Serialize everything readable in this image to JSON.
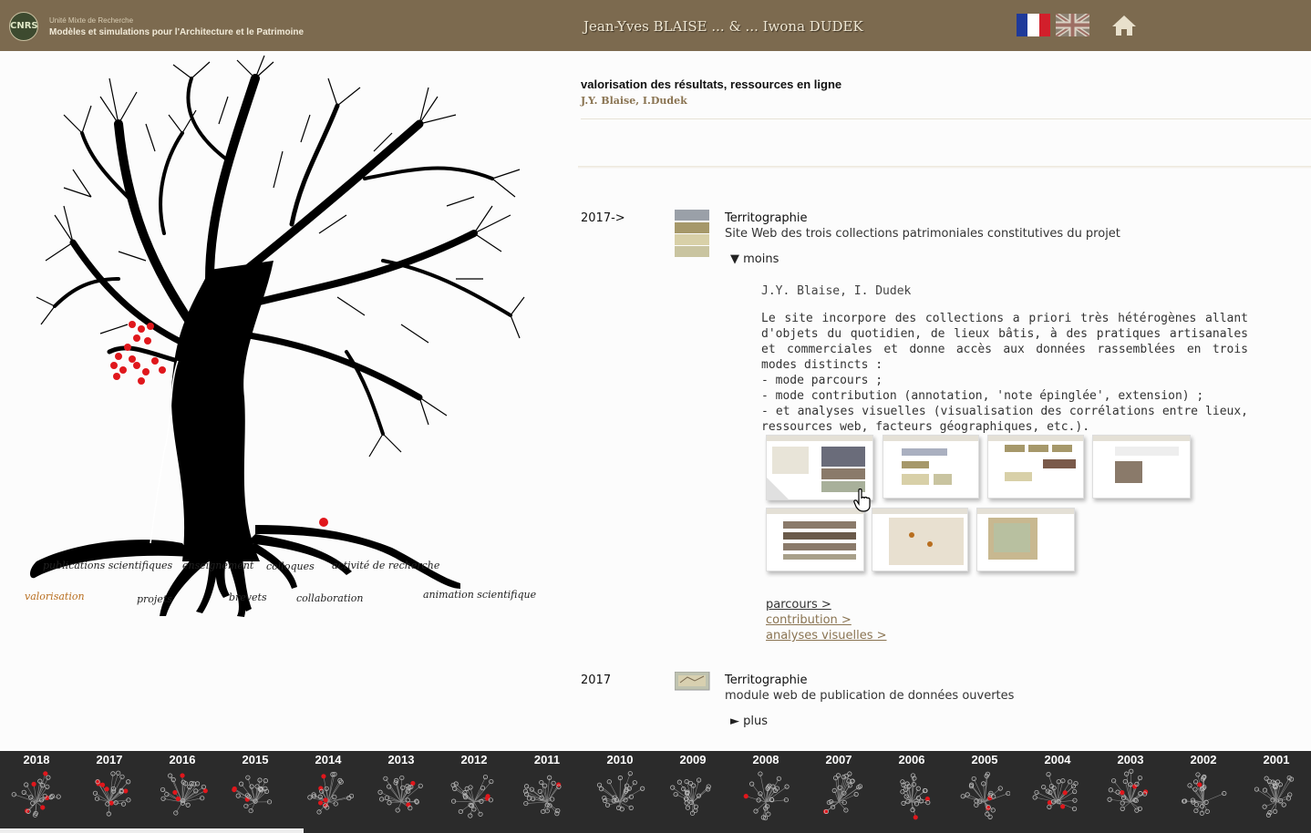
{
  "header": {
    "lab_small": "Unité Mixte de Recherche",
    "lab_name": "Modèles et simulations pour l'Architecture et le Patrimoine",
    "logo_text": "CNRS",
    "authors": "Jean-Yves BLAISE ... & ... Iwona DUDEK",
    "bg_color": "#7c6a4f"
  },
  "tree": {
    "labels": {
      "publications": "publications scientifiques",
      "enseignement": "enseignement",
      "colloques": "colloques",
      "activite": "activité de recherche",
      "valorisation": "valorisation",
      "projets": "projets",
      "brevets": "brevets",
      "collaboration": "collaboration",
      "animation": "animation scientifique"
    },
    "active": "valorisation",
    "active_color": "#b86e1f",
    "fruit_color": "#e0171c"
  },
  "section": {
    "title": "valorisation des résultats, ressources en ligne",
    "authors": "J.Y. Blaise, I.Dudek"
  },
  "entries": [
    {
      "year": "2017->",
      "title": "Territographie",
      "subtitle": "Site Web des trois collections patrimoniales constitutives du projet",
      "toggle": "▼ moins",
      "authors": "J.Y. Blaise, I. Dudek",
      "description": [
        "Le site incorpore des collections a priori très hétérogènes allant d'objets du quotidien, de lieux bâtis, à des pratiques artisanales et commerciales et donne accès aux données rassemblées en trois modes distincts :",
        "- mode parcours ;",
        "- mode contribution (annotation, 'note épinglée', extension) ;",
        "- et analyses visuelles (visualisation des corrélations entre lieux, ressources web, facteurs géographiques, etc.)."
      ],
      "links": [
        "parcours >",
        "contribution >",
        "analyses visuelles >"
      ]
    },
    {
      "year": "2017",
      "title": "Territographie",
      "subtitle": "module web de publication de données ouvertes",
      "toggle": "► plus"
    }
  ],
  "timeline": [
    "2018",
    "2017",
    "2016",
    "2015",
    "2014",
    "2013",
    "2012",
    "2011",
    "2010",
    "2009",
    "2008",
    "2007",
    "2006",
    "2005",
    "2004",
    "2003",
    "2002",
    "2001"
  ]
}
